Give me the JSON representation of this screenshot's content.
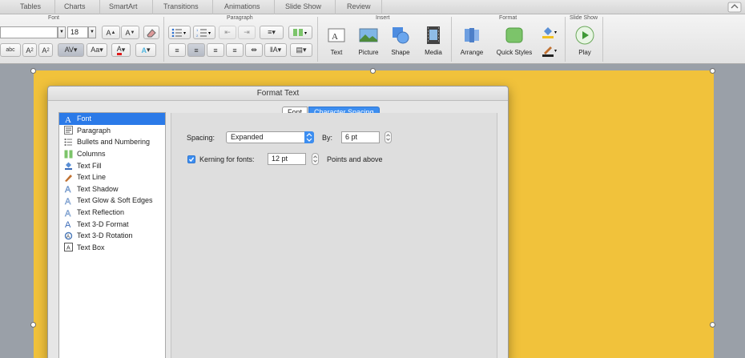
{
  "ribbon_tabs": [
    "Tables",
    "Charts",
    "SmartArt",
    "Transitions",
    "Animations",
    "Slide Show",
    "Review"
  ],
  "groups": {
    "font": "Font",
    "paragraph": "Paragraph",
    "insert": "Insert",
    "format": "Format",
    "slideshow": "Slide Show"
  },
  "font_size": "18",
  "insert_buttons": {
    "text": "Text",
    "picture": "Picture",
    "shape": "Shape",
    "media": "Media"
  },
  "format_buttons": {
    "arrange": "Arrange",
    "quick_styles": "Quick Styles"
  },
  "slideshow_buttons": {
    "play": "Play"
  },
  "dialog": {
    "title": "Format Text",
    "tabs": [
      "Font",
      "Character Spacing"
    ],
    "selected_tab": "Character Spacing",
    "categories": [
      {
        "label": "Font",
        "icon": "font-a-icon"
      },
      {
        "label": "Paragraph",
        "icon": "paragraph-icon"
      },
      {
        "label": "Bullets and Numbering",
        "icon": "bullets-icon"
      },
      {
        "label": "Columns",
        "icon": "columns-icon"
      },
      {
        "label": "Text Fill",
        "icon": "paint-bucket-icon"
      },
      {
        "label": "Text Line",
        "icon": "pen-icon"
      },
      {
        "label": "Text Shadow",
        "icon": "shadow-a-icon"
      },
      {
        "label": "Text Glow & Soft Edges",
        "icon": "glow-a-icon"
      },
      {
        "label": "Text Reflection",
        "icon": "reflection-a-icon"
      },
      {
        "label": "Text 3-D Format",
        "icon": "3d-a-icon"
      },
      {
        "label": "Text 3-D Rotation",
        "icon": "rotation-icon"
      },
      {
        "label": "Text Box",
        "icon": "text-box-icon"
      }
    ],
    "selected_category": "Font",
    "spacing_label": "Spacing:",
    "spacing_value": "Expanded",
    "by_label": "By:",
    "by_value": "6 pt",
    "kerning_label": "Kerning for fonts:",
    "kerning_checked": true,
    "kerning_value": "12 pt",
    "kerning_suffix": "Points and above"
  },
  "colors": {
    "slide": "#f1c23b",
    "selection": "#2b7ae8"
  }
}
